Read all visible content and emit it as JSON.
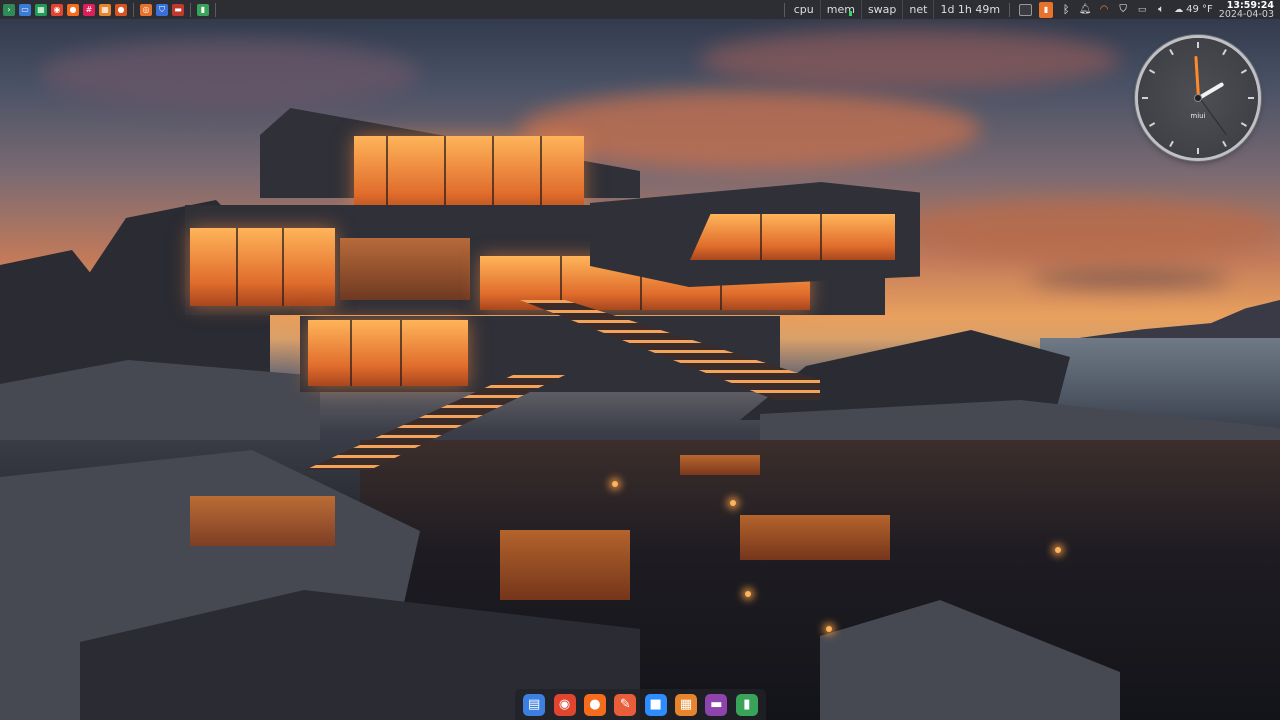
{
  "top_panel": {
    "launchers_left": [
      {
        "icon": "terminal-icon",
        "color": "#2e8b57"
      },
      {
        "icon": "desktop-icon",
        "color": "#3a7bd5"
      },
      {
        "icon": "spreadsheet-icon",
        "color": "#1f9d55"
      },
      {
        "icon": "chrome-icon",
        "color": "#e0452f"
      },
      {
        "icon": "firefox-icon",
        "color": "#f76b1c"
      },
      {
        "icon": "slack-icon",
        "color": "#e01e5a"
      },
      {
        "icon": "grid-apps-icon",
        "color": "#e7852d"
      },
      {
        "icon": "firefox-dev-icon",
        "color": "#d9541e"
      }
    ],
    "launchers_mid": [
      {
        "icon": "browser-icon",
        "color": "#e8712b"
      },
      {
        "icon": "bitwarden-icon",
        "color": "#3b6fd8"
      },
      {
        "icon": "media-icon",
        "color": "#c0392b"
      }
    ],
    "launchers_right": [
      {
        "icon": "trash-icon",
        "color": "#3aa35a"
      }
    ],
    "monitors": {
      "cpu": "cpu",
      "mem": "mem",
      "swap": "swap",
      "net": "net",
      "uptime": "1d 1h 49m"
    },
    "weather": "49 °F",
    "clock_time": "13:59:24",
    "clock_date": "2024-04-03"
  },
  "clock_widget": {
    "brand": "miui",
    "hour": 13,
    "minute": 59,
    "second": 24,
    "accent_color": "#ff8a2a"
  },
  "dock": {
    "items": [
      {
        "icon": "file-manager-icon",
        "color": "#3d7fe0"
      },
      {
        "icon": "chrome-icon",
        "color": "#e0452f"
      },
      {
        "icon": "firefox-icon",
        "color": "#f76b1c"
      },
      {
        "icon": "text-editor-icon",
        "color": "#e85d3a"
      },
      {
        "icon": "video-call-icon",
        "color": "#2d8cff"
      },
      {
        "icon": "calculator-icon",
        "color": "#e7852d"
      },
      {
        "icon": "screenshot-icon",
        "color": "#8e44ad"
      },
      {
        "icon": "trash-icon",
        "color": "#3aa35a"
      }
    ]
  }
}
